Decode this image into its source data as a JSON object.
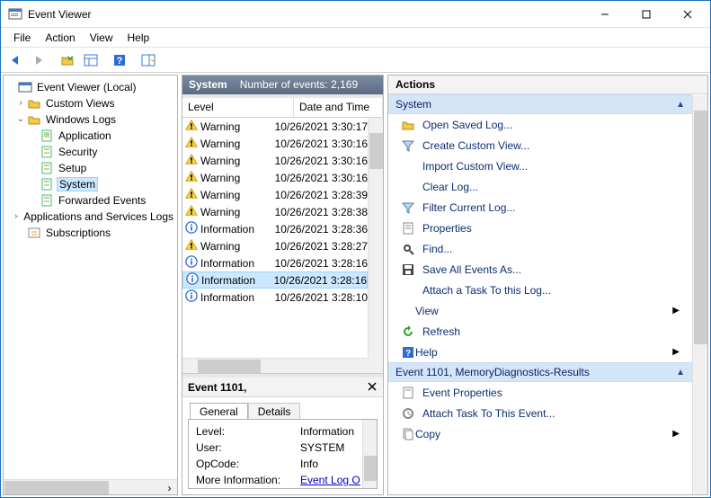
{
  "window": {
    "title": "Event Viewer",
    "menu": [
      "File",
      "Action",
      "View",
      "Help"
    ]
  },
  "tree": {
    "root": "Event Viewer (Local)",
    "customViews": "Custom Views",
    "windowsLogs": "Windows Logs",
    "winChildren": {
      "application": "Application",
      "security": "Security",
      "setup": "Setup",
      "system": "System",
      "forwarded": "Forwarded Events"
    },
    "appServ": "Applications and Services Logs",
    "subscriptions": "Subscriptions"
  },
  "eventsHeader": {
    "title": "System",
    "count": "Number of events: 2,169"
  },
  "columns": {
    "level": "Level",
    "datetime": "Date and Time"
  },
  "events": [
    {
      "level": "Warning",
      "date": "10/26/2021 3:30:17"
    },
    {
      "level": "Warning",
      "date": "10/26/2021 3:30:16"
    },
    {
      "level": "Warning",
      "date": "10/26/2021 3:30:16"
    },
    {
      "level": "Warning",
      "date": "10/26/2021 3:30:16"
    },
    {
      "level": "Warning",
      "date": "10/26/2021 3:28:39"
    },
    {
      "level": "Warning",
      "date": "10/26/2021 3:28:38"
    },
    {
      "level": "Information",
      "date": "10/26/2021 3:28:36"
    },
    {
      "level": "Warning",
      "date": "10/26/2021 3:28:27"
    },
    {
      "level": "Information",
      "date": "10/26/2021 3:28:16"
    },
    {
      "level": "Information",
      "date": "10/26/2021 3:28:16",
      "selected": true
    },
    {
      "level": "Information",
      "date": "10/26/2021 3:28:10"
    }
  ],
  "detail": {
    "title": "Event 1101,",
    "tabs": {
      "general": "General",
      "details": "Details"
    },
    "fields": {
      "levelK": "Level:",
      "levelV": "Information",
      "userK": "User:",
      "userV": "SYSTEM",
      "opK": "OpCode:",
      "opV": "Info",
      "moreK": "More Information:",
      "moreV": "Event Log O"
    }
  },
  "actions": {
    "title": "Actions",
    "group1": "System",
    "items1": {
      "open": "Open Saved Log...",
      "createView": "Create Custom View...",
      "importView": "Import Custom View...",
      "clear": "Clear Log...",
      "filter": "Filter Current Log...",
      "props": "Properties",
      "find": "Find...",
      "saveAll": "Save All Events As...",
      "attach": "Attach a Task To this Log...",
      "view": "View",
      "refresh": "Refresh",
      "help": "Help"
    },
    "group2": "Event 1101, MemoryDiagnostics-Results",
    "items2": {
      "evProps": "Event Properties",
      "evAttach": "Attach Task To This Event...",
      "copy": "Copy"
    }
  }
}
